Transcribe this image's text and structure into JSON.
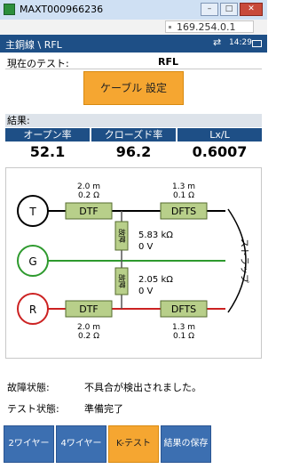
{
  "window": {
    "title": "MAXT000966236"
  },
  "addressbar": {
    "ip": "169.254.0.1"
  },
  "navbar": {
    "breadcrumb": "主銅線 \\ RFL",
    "time": "14:29",
    "icon_glyph": "⇄"
  },
  "current_test": {
    "label": "現在のテスト:",
    "value": "RFL"
  },
  "cable_settings_button": "ケーブル 設定",
  "results": {
    "header": "結果:",
    "columns": [
      {
        "label": "オープン率",
        "value": "52.1"
      },
      {
        "label": "クローズド率",
        "value": "96.2"
      },
      {
        "label": "Lx/L",
        "value": "0.6007"
      }
    ]
  },
  "diagram": {
    "nodes": [
      "T",
      "G",
      "R"
    ],
    "top_left": {
      "block": "DTF",
      "length": "2.0 m",
      "resistance": "0.2 Ω"
    },
    "top_right": {
      "block": "DFTS",
      "length": "1.3 m",
      "resistance": "0.1 Ω"
    },
    "bottom_left": {
      "block": "DTF",
      "length": "2.0 m",
      "resistance": "0.2 Ω"
    },
    "bottom_right": {
      "block": "DFTS",
      "length": "1.3 m",
      "resistance": "0.1 Ω"
    },
    "fault_upper": {
      "label": "故障",
      "resistance": "5.83 kΩ",
      "voltage": "0 V"
    },
    "fault_lower": {
      "label": "故障",
      "resistance": "2.05 kΩ",
      "voltage": "0 V"
    },
    "strap_label": "ストラップ",
    "colors": {
      "t_line": "#000000",
      "g_line": "#2e9a2e",
      "r_line": "#cc2222",
      "block_fill": "#b8cf8a",
      "block_stroke": "#556b2f"
    }
  },
  "status": {
    "fault_label": "故障状態:",
    "fault_value": "不具合が検出されました。",
    "test_label": "テスト状態:",
    "test_value": "準備完了"
  },
  "bottom_buttons": [
    {
      "label": "2ワイヤー",
      "active": false
    },
    {
      "label": "4ワイヤー",
      "active": false
    },
    {
      "label": "K-テスト",
      "active": true
    },
    {
      "label": "結果の保存",
      "active": false
    }
  ]
}
